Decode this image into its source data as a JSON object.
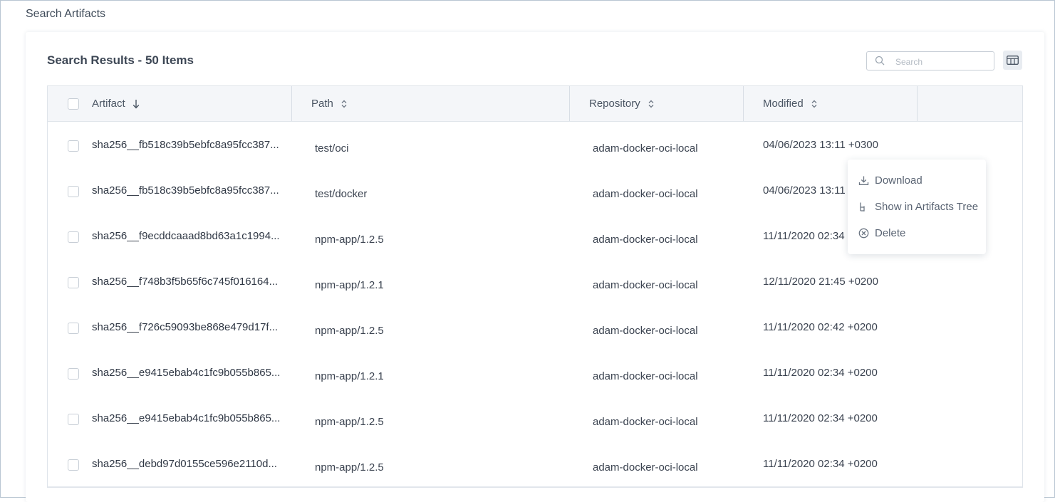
{
  "page": {
    "title": "Search Artifacts"
  },
  "results": {
    "title": "Search Results - 50 Items"
  },
  "search": {
    "placeholder": "Search",
    "value": ""
  },
  "table": {
    "columns": [
      {
        "label": "Artifact",
        "sort": "descending"
      },
      {
        "label": "Path",
        "sort": "none"
      },
      {
        "label": "Repository",
        "sort": "none"
      },
      {
        "label": "Modified",
        "sort": "none"
      }
    ],
    "rows": [
      {
        "artifact": "sha256__fb518c39b5ebfc8a95fcc387...",
        "path": "test/oci",
        "repository": "adam-docker-oci-local",
        "modified": "04/06/2023 13:11 +0300"
      },
      {
        "artifact": "sha256__fb518c39b5ebfc8a95fcc387...",
        "path": "test/docker",
        "repository": "adam-docker-oci-local",
        "modified": "04/06/2023 13:11 +"
      },
      {
        "artifact": "sha256__f9ecddcaaad8bd63a1c1994...",
        "path": "npm-app/1.2.5",
        "repository": "adam-docker-oci-local",
        "modified": "11/11/2020 02:34 +"
      },
      {
        "artifact": "sha256__f748b3f5b65f6c745f016164...",
        "path": "npm-app/1.2.1",
        "repository": "adam-docker-oci-local",
        "modified": "12/11/2020 21:45 +0200"
      },
      {
        "artifact": "sha256__f726c59093be868e479d17f...",
        "path": "npm-app/1.2.5",
        "repository": "adam-docker-oci-local",
        "modified": "11/11/2020 02:42 +0200"
      },
      {
        "artifact": "sha256__e9415ebab4c1fc9b055b865...",
        "path": "npm-app/1.2.1",
        "repository": "adam-docker-oci-local",
        "modified": "11/11/2020 02:34 +0200"
      },
      {
        "artifact": "sha256__e9415ebab4c1fc9b055b865...",
        "path": "npm-app/1.2.5",
        "repository": "adam-docker-oci-local",
        "modified": "11/11/2020 02:34 +0200"
      },
      {
        "artifact": "sha256__debd97d0155ce596e2110d...",
        "path": "npm-app/1.2.5",
        "repository": "adam-docker-oci-local",
        "modified": "11/11/2020 02:34 +0200"
      }
    ]
  },
  "context_menu": {
    "items": [
      {
        "label": "Download",
        "icon": "download-icon"
      },
      {
        "label": "Show in Artifacts Tree",
        "icon": "tree-icon"
      },
      {
        "label": "Delete",
        "icon": "delete-circle-icon"
      }
    ]
  },
  "colors": {
    "border": "#b9c6d2",
    "header_bg": "#f4f6f9",
    "text": "#3b4350",
    "accent_button_bg": "#e8ecf1"
  }
}
